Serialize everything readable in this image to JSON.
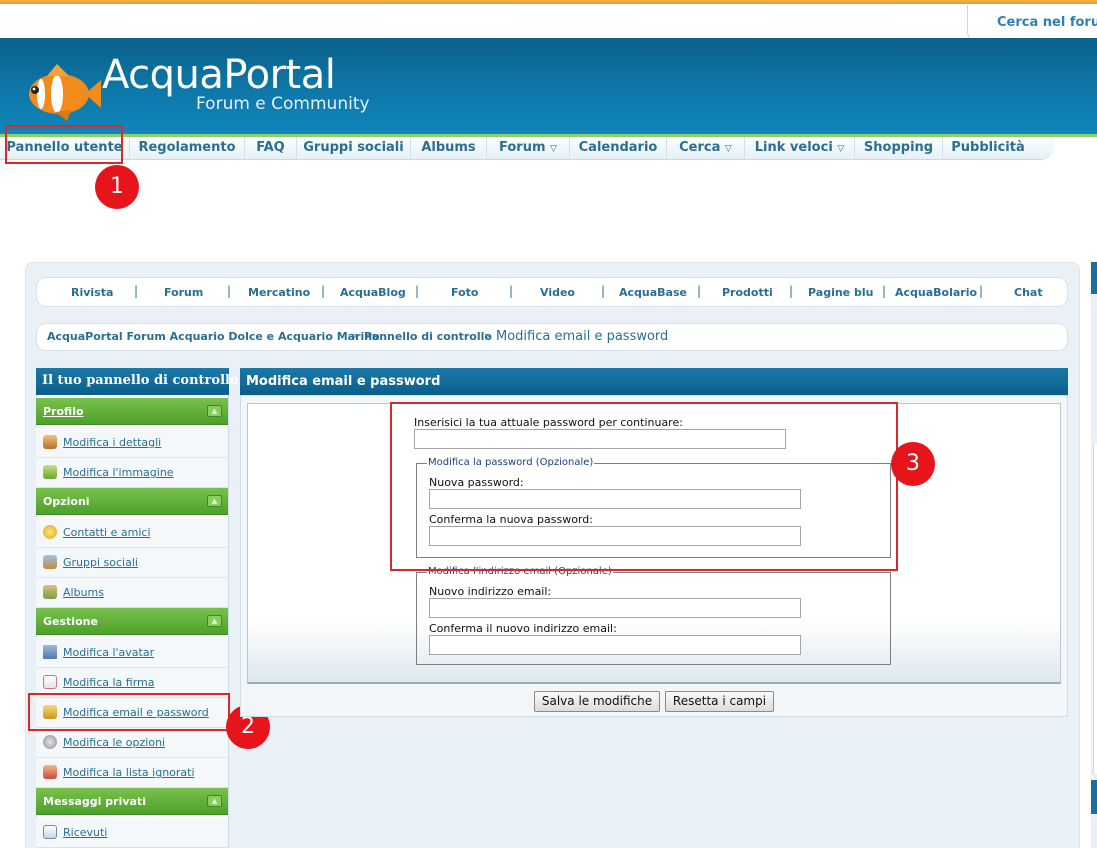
{
  "search_tab": {
    "label": "Cerca nel forum"
  },
  "header": {
    "logo_title": "AcquaPortal",
    "logo_subtitle": "Forum e Community"
  },
  "nav": {
    "items": [
      {
        "label": "Pannello utente",
        "dropdown": false
      },
      {
        "label": "Regolamento",
        "dropdown": false
      },
      {
        "label": "FAQ",
        "dropdown": false
      },
      {
        "label": "Gruppi sociali",
        "dropdown": false
      },
      {
        "label": "Albums",
        "dropdown": false
      },
      {
        "label": "Forum",
        "dropdown": true
      },
      {
        "label": "Calendario",
        "dropdown": false
      },
      {
        "label": "Cerca",
        "dropdown": true
      },
      {
        "label": "Link veloci",
        "dropdown": true
      },
      {
        "label": "Shopping",
        "dropdown": false
      },
      {
        "label": "Pubblicità",
        "dropdown": false
      }
    ],
    "dropdown_glyph": "▽"
  },
  "quick_links": [
    "Rivista",
    "Forum",
    "Mercatino",
    "AcquaBlog",
    "Foto",
    "Video",
    "AcquaBase",
    "Prodotti",
    "Pagine blu",
    "AcquaBolario",
    "Chat"
  ],
  "separator": "|",
  "breadcrumb": {
    "items": [
      "AcquaPortal Forum Acquario Dolce e Acquario Marino",
      "Pannello di controllo"
    ],
    "current": "Modifica email e password",
    "sep": "»"
  },
  "sidebar": {
    "title": "Il tuo pannello di controllo",
    "toggle_glyph": "▲",
    "sections": [
      {
        "label": "Profilo",
        "items": [
          {
            "label": "Modifica i dettagli",
            "icon": "user-edit-icon"
          },
          {
            "label": "Modifica l'immagine",
            "icon": "picture-edit-icon"
          }
        ]
      },
      {
        "label": "Opzioni",
        "items": [
          {
            "label": "Contatti e amici",
            "icon": "smiley-icon"
          },
          {
            "label": "Gruppi sociali",
            "icon": "group-icon"
          },
          {
            "label": "Albums",
            "icon": "album-icon"
          }
        ]
      },
      {
        "label": "Gestione",
        "items": [
          {
            "label": "Modifica l'avatar",
            "icon": "avatar-icon"
          },
          {
            "label": "Modifica la firma",
            "icon": "signature-icon"
          },
          {
            "label": "Modifica email e password",
            "icon": "lock-icon"
          },
          {
            "label": "Modifica le opzioni",
            "icon": "gear-icon"
          },
          {
            "label": "Modifica la lista ignorati",
            "icon": "ignore-user-icon"
          }
        ]
      },
      {
        "label": "Messaggi privati",
        "items": [
          {
            "label": "Ricevuti",
            "icon": "inbox-icon"
          }
        ]
      }
    ]
  },
  "main": {
    "title": "Modifica email e password",
    "current_password_label": "Inserisici la tua attuale password per continuare:",
    "password_fieldset": {
      "legend": "Modifica la password (Opzionale)",
      "new_label": "Nuova password:",
      "confirm_label": "Conferma la nuova password:"
    },
    "email_fieldset": {
      "legend": "Modifica l'indirizzo email (Opzionale)",
      "new_label": "Nuovo indirizzo email:",
      "confirm_label": "Conferma il nuovo indirizzo email:"
    },
    "save_button": "Salva le modifiche",
    "reset_button": "Resetta i campi"
  },
  "annotations": [
    "1",
    "2",
    "3"
  ],
  "colors": {
    "header_blue": "#0d74a3",
    "accent_orange": "#e7982a",
    "section_green": "#4ea02c",
    "link_blue": "#2a6f93",
    "annotation_red": "#d9282b"
  }
}
